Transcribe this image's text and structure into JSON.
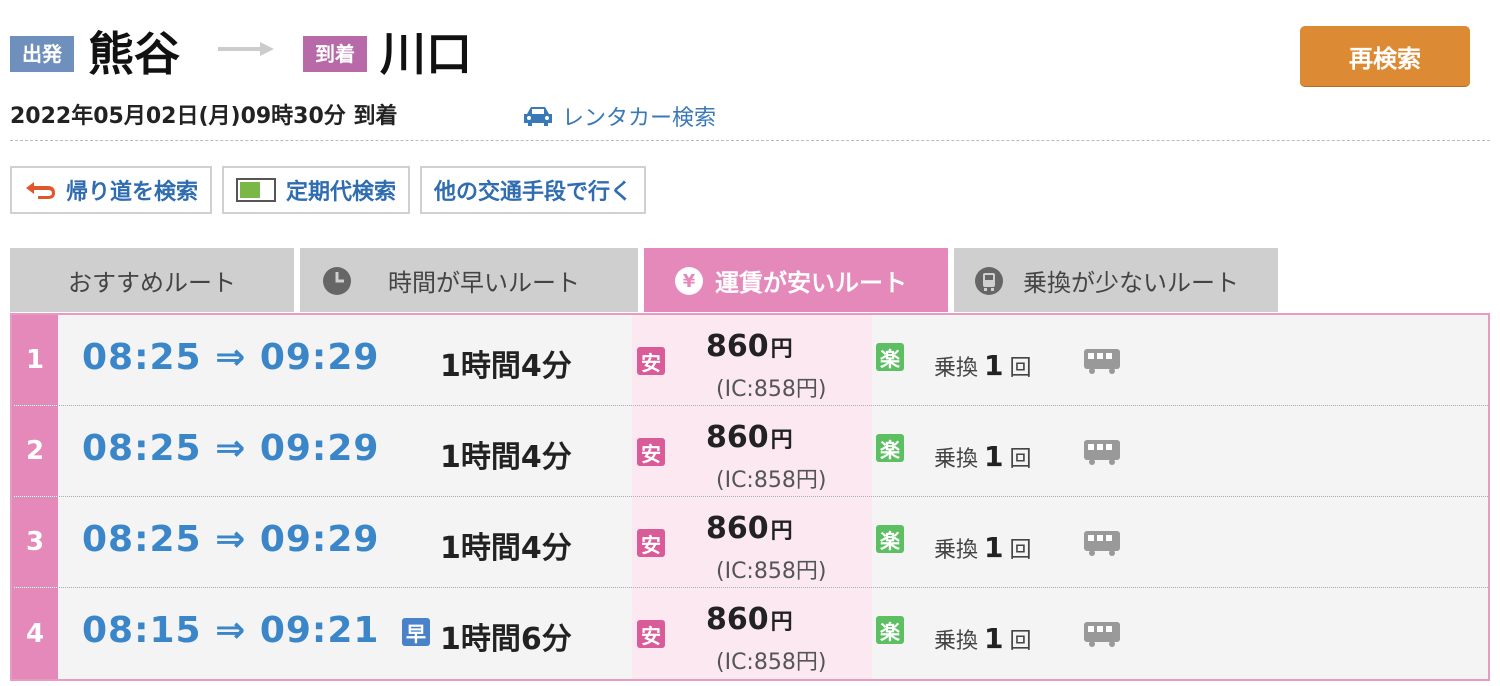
{
  "header": {
    "departure_tag": "出発",
    "departure_station": "熊谷",
    "arrival_tag": "到着",
    "arrival_station": "川口",
    "research_label": "再検索",
    "datetime": "2022年05月02日(月)09時30分 到着",
    "rental_car_label": "レンタカー検索"
  },
  "actions": [
    {
      "label": "帰り道を検索",
      "icon": "return-arrow-icon"
    },
    {
      "label": "定期代検索",
      "icon": "commuter-pass-icon"
    },
    {
      "label": "他の交通手段で行く",
      "icon": ""
    }
  ],
  "tabs": [
    {
      "label": "おすすめルート",
      "icon": ""
    },
    {
      "label": "時間が早いルート",
      "icon": "clock-icon"
    },
    {
      "label": "運賃が安いルート",
      "icon": "yen-icon",
      "active": true
    },
    {
      "label": "乗換が少ないルート",
      "icon": "train-front-icon"
    }
  ],
  "routes": [
    {
      "num": "1",
      "times": "08:25 ⇒ 09:29",
      "early": false,
      "duration": "1時間4分",
      "cheap_badge": "安",
      "fare": "860",
      "yen": "円",
      "ic_fare": "(IC:858円)",
      "easy_badge": "楽",
      "transfer_label": "乗換",
      "transfer_count": "1",
      "transfer_unit": "回"
    },
    {
      "num": "2",
      "times": "08:25 ⇒ 09:29",
      "early": false,
      "duration": "1時間4分",
      "cheap_badge": "安",
      "fare": "860",
      "yen": "円",
      "ic_fare": "(IC:858円)",
      "easy_badge": "楽",
      "transfer_label": "乗換",
      "transfer_count": "1",
      "transfer_unit": "回"
    },
    {
      "num": "3",
      "times": "08:25 ⇒ 09:29",
      "early": false,
      "duration": "1時間4分",
      "cheap_badge": "安",
      "fare": "860",
      "yen": "円",
      "ic_fare": "(IC:858円)",
      "easy_badge": "楽",
      "transfer_label": "乗換",
      "transfer_count": "1",
      "transfer_unit": "回"
    },
    {
      "num": "4",
      "times": "08:15 ⇒ 09:21",
      "early": true,
      "early_badge": "早",
      "duration": "1時間6分",
      "cheap_badge": "安",
      "fare": "860",
      "yen": "円",
      "ic_fare": "(IC:858円)",
      "easy_badge": "楽",
      "transfer_label": "乗換",
      "transfer_count": "1",
      "transfer_unit": "回"
    }
  ],
  "colors": {
    "accent_pink": "#e589bb",
    "link_blue": "#3a86c8",
    "research_orange": "#dd8a35"
  }
}
